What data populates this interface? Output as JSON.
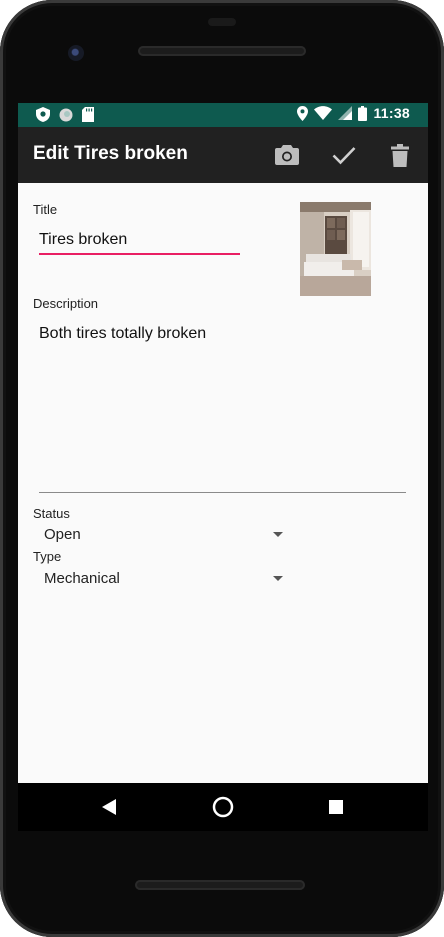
{
  "status_bar": {
    "time": "11:38",
    "left_icons": [
      "shield-icon",
      "circle-icon",
      "sd-card-icon"
    ],
    "right_icons": [
      "location-icon",
      "wifi-icon",
      "signal-icon",
      "battery-icon"
    ]
  },
  "app_bar": {
    "title": "Edit Tires broken",
    "actions": [
      "camera-icon",
      "check-icon",
      "delete-icon"
    ]
  },
  "form": {
    "title_label": "Title",
    "title_value": "Tires broken",
    "description_label": "Description",
    "description_value": "Both tires totally broken",
    "status_label": "Status",
    "status_value": "Open",
    "type_label": "Type",
    "type_value": "Mechanical"
  },
  "nav_bar": {
    "buttons": [
      "back-icon",
      "home-icon",
      "recents-icon"
    ]
  },
  "colors": {
    "status_bar": "#0e5a4f",
    "app_bar": "#212121",
    "accent": "#e91e63"
  }
}
